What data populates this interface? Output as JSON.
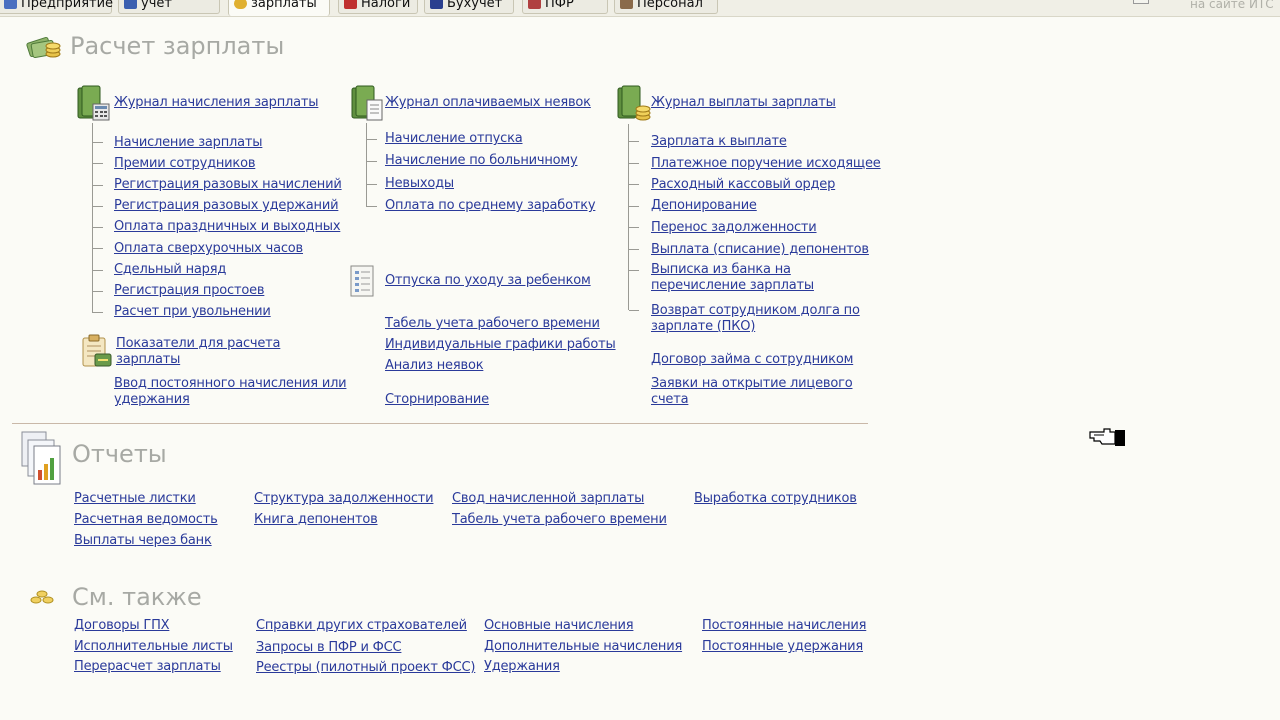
{
  "tabs": [
    {
      "label": "Предприятие",
      "color": "#4a6fc0"
    },
    {
      "label": "учет",
      "color": "#3b5fb0"
    },
    {
      "label": "зарплаты",
      "color": "#e0b030"
    },
    {
      "label": "Налоги",
      "color": "#c03030"
    },
    {
      "label": "Бухучет",
      "color": "#2a3f8f"
    },
    {
      "label": "ПФР",
      "color": "#b04040"
    },
    {
      "label": "Персонал",
      "color": "#8a6a4a"
    }
  ],
  "header_right": "на сайте ИТС",
  "payroll": {
    "title": "Расчет зарплаты",
    "col1": {
      "journal": "Журнал начисления зарплаты",
      "items": [
        "Начисление зарплаты",
        "Премии сотрудников",
        "Регистрация разовых начислений",
        "Регистрация разовых удержаний",
        "Оплата праздничных и выходных",
        "Оплата сверхурочных часов",
        "Сдельный наряд",
        "Регистрация простоев",
        "Расчет при увольнении"
      ],
      "indicators_line1": "Показатели для расчета",
      "indicators_line2": "зарплаты",
      "permanent_line1": "Ввод постоянного начисления или",
      "permanent_line2": "удержания"
    },
    "col2": {
      "journal": "Журнал оплачиваемых неявок",
      "items": [
        "Начисление отпуска",
        "Начисление по больничному",
        "Невыходы",
        "Оплата по среднему заработку"
      ],
      "childcare": "Отпуска по уходу за ребенком",
      "extra": [
        "Табель учета рабочего времени",
        "Индивидуальные графики работы",
        "Анализ неявок"
      ],
      "reversal": "Сторнирование"
    },
    "col3": {
      "journal": "Журнал выплаты зарплаты",
      "items": [
        "Зарплата к выплате",
        "Платежное поручение исходящее",
        "Расходный кассовый ордер",
        "Депонирование",
        "Перенос задолженности",
        "Выплата (списание) депонентов"
      ],
      "bank_line1": "Выписка из банка на",
      "bank_line2": "перечисление зарплаты",
      "refund_line1": "Возврат сотрудником долга по",
      "refund_line2": "зарплате (ПКО)",
      "loan": "Договор займа с сотрудником",
      "account_line1": "Заявки на открытие лицевого",
      "account_line2": "счета"
    }
  },
  "reports": {
    "title": "Отчеты",
    "col1": [
      "Расчетные листки",
      "Расчетная ведомость",
      "Выплаты через банк"
    ],
    "col2": [
      "Структура задолженности",
      "Книга депонентов"
    ],
    "col3": [
      "Свод начисленной зарплаты",
      "Табель учета рабочего времени"
    ],
    "col4": [
      "Выработка сотрудников"
    ]
  },
  "see_also": {
    "title": "См. также",
    "col1": [
      "Договоры ГПХ",
      "Исполнительные листы",
      "Перерасчет зарплаты"
    ],
    "col2": [
      "Справки других страхователей",
      "Запросы в ПФР и ФСС",
      "Реестры (пилотный проект ФСС)"
    ],
    "col3": [
      "Основные начисления",
      "Дополнительные начисления",
      "Удержания"
    ],
    "col4": [
      "Постоянные начисления",
      "Постоянные удержания"
    ]
  },
  "colors": {
    "link": "#2a3a9a",
    "section_title": "#a7a9a4",
    "background": "#fbfbf6"
  }
}
